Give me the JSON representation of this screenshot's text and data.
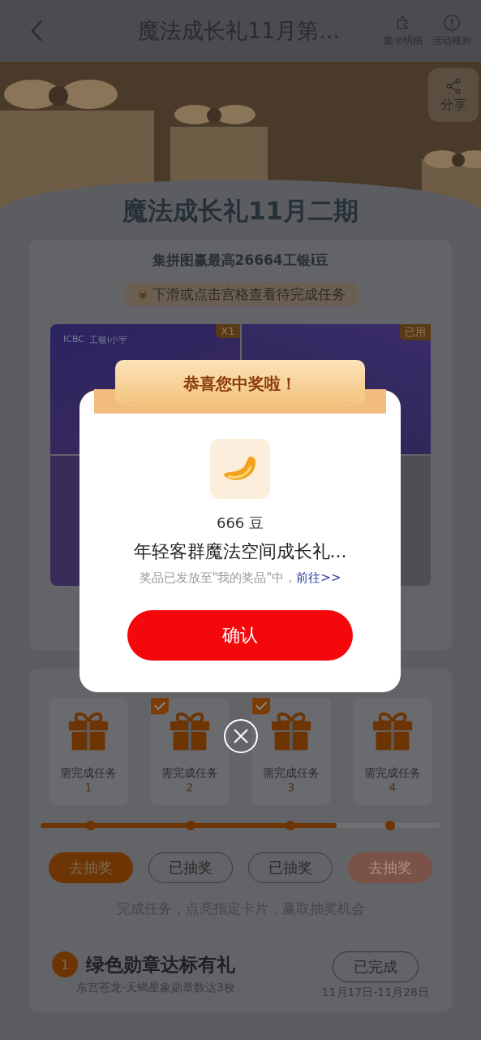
{
  "header": {
    "title": "魔法成长礼11月第...",
    "actions": [
      {
        "label": "集卡明细",
        "kind": "puzzle"
      },
      {
        "label": "活动规则",
        "kind": "info"
      }
    ]
  },
  "share": {
    "label": "分享"
  },
  "activity": {
    "title": "魔法成长礼11月二期",
    "subtitle": "集拼图赢最高26664工银i豆",
    "hint": "下滑或点击宫格查看待完成任务"
  },
  "puzzle": {
    "brand": "ICBC",
    "brand_name": "工银i小宇",
    "cells": [
      {
        "badge": "X1"
      },
      {
        "badge": "已用"
      },
      {},
      {}
    ]
  },
  "rewards": [
    {
      "label": "需完成任务",
      "number": "1",
      "checked": false
    },
    {
      "label": "需完成任务",
      "number": "2",
      "checked": true
    },
    {
      "label": "需完成任务",
      "number": "3",
      "checked": true
    },
    {
      "label": "需完成任务",
      "number": "4",
      "checked": false
    }
  ],
  "progress": {
    "level": 0.74
  },
  "draw_buttons": [
    {
      "label": "去抽奖",
      "kind": "primary"
    },
    {
      "label": "已抽奖",
      "kind": "outline"
    },
    {
      "label": "已抽奖",
      "kind": "outline"
    },
    {
      "label": "去抽奖",
      "kind": "disabled"
    }
  ],
  "caption": "完成任务，点亮指定卡片，赢取抽奖机会",
  "tasks": [
    {
      "index": "1",
      "title": "绿色勋章达标有礼",
      "desc": "东宫苍龙-天蝎星象勋章数达3枚",
      "status": "已完成",
      "date": "11月17日-11月28日"
    }
  ],
  "modal": {
    "banner": "恭喜您中奖啦！",
    "amount": "666 豆",
    "prize": "年轻客群魔法空间成长礼...",
    "note": "奖品已发放至\"我的奖品\"中，",
    "link": "前往>>",
    "confirm": "确认"
  }
}
